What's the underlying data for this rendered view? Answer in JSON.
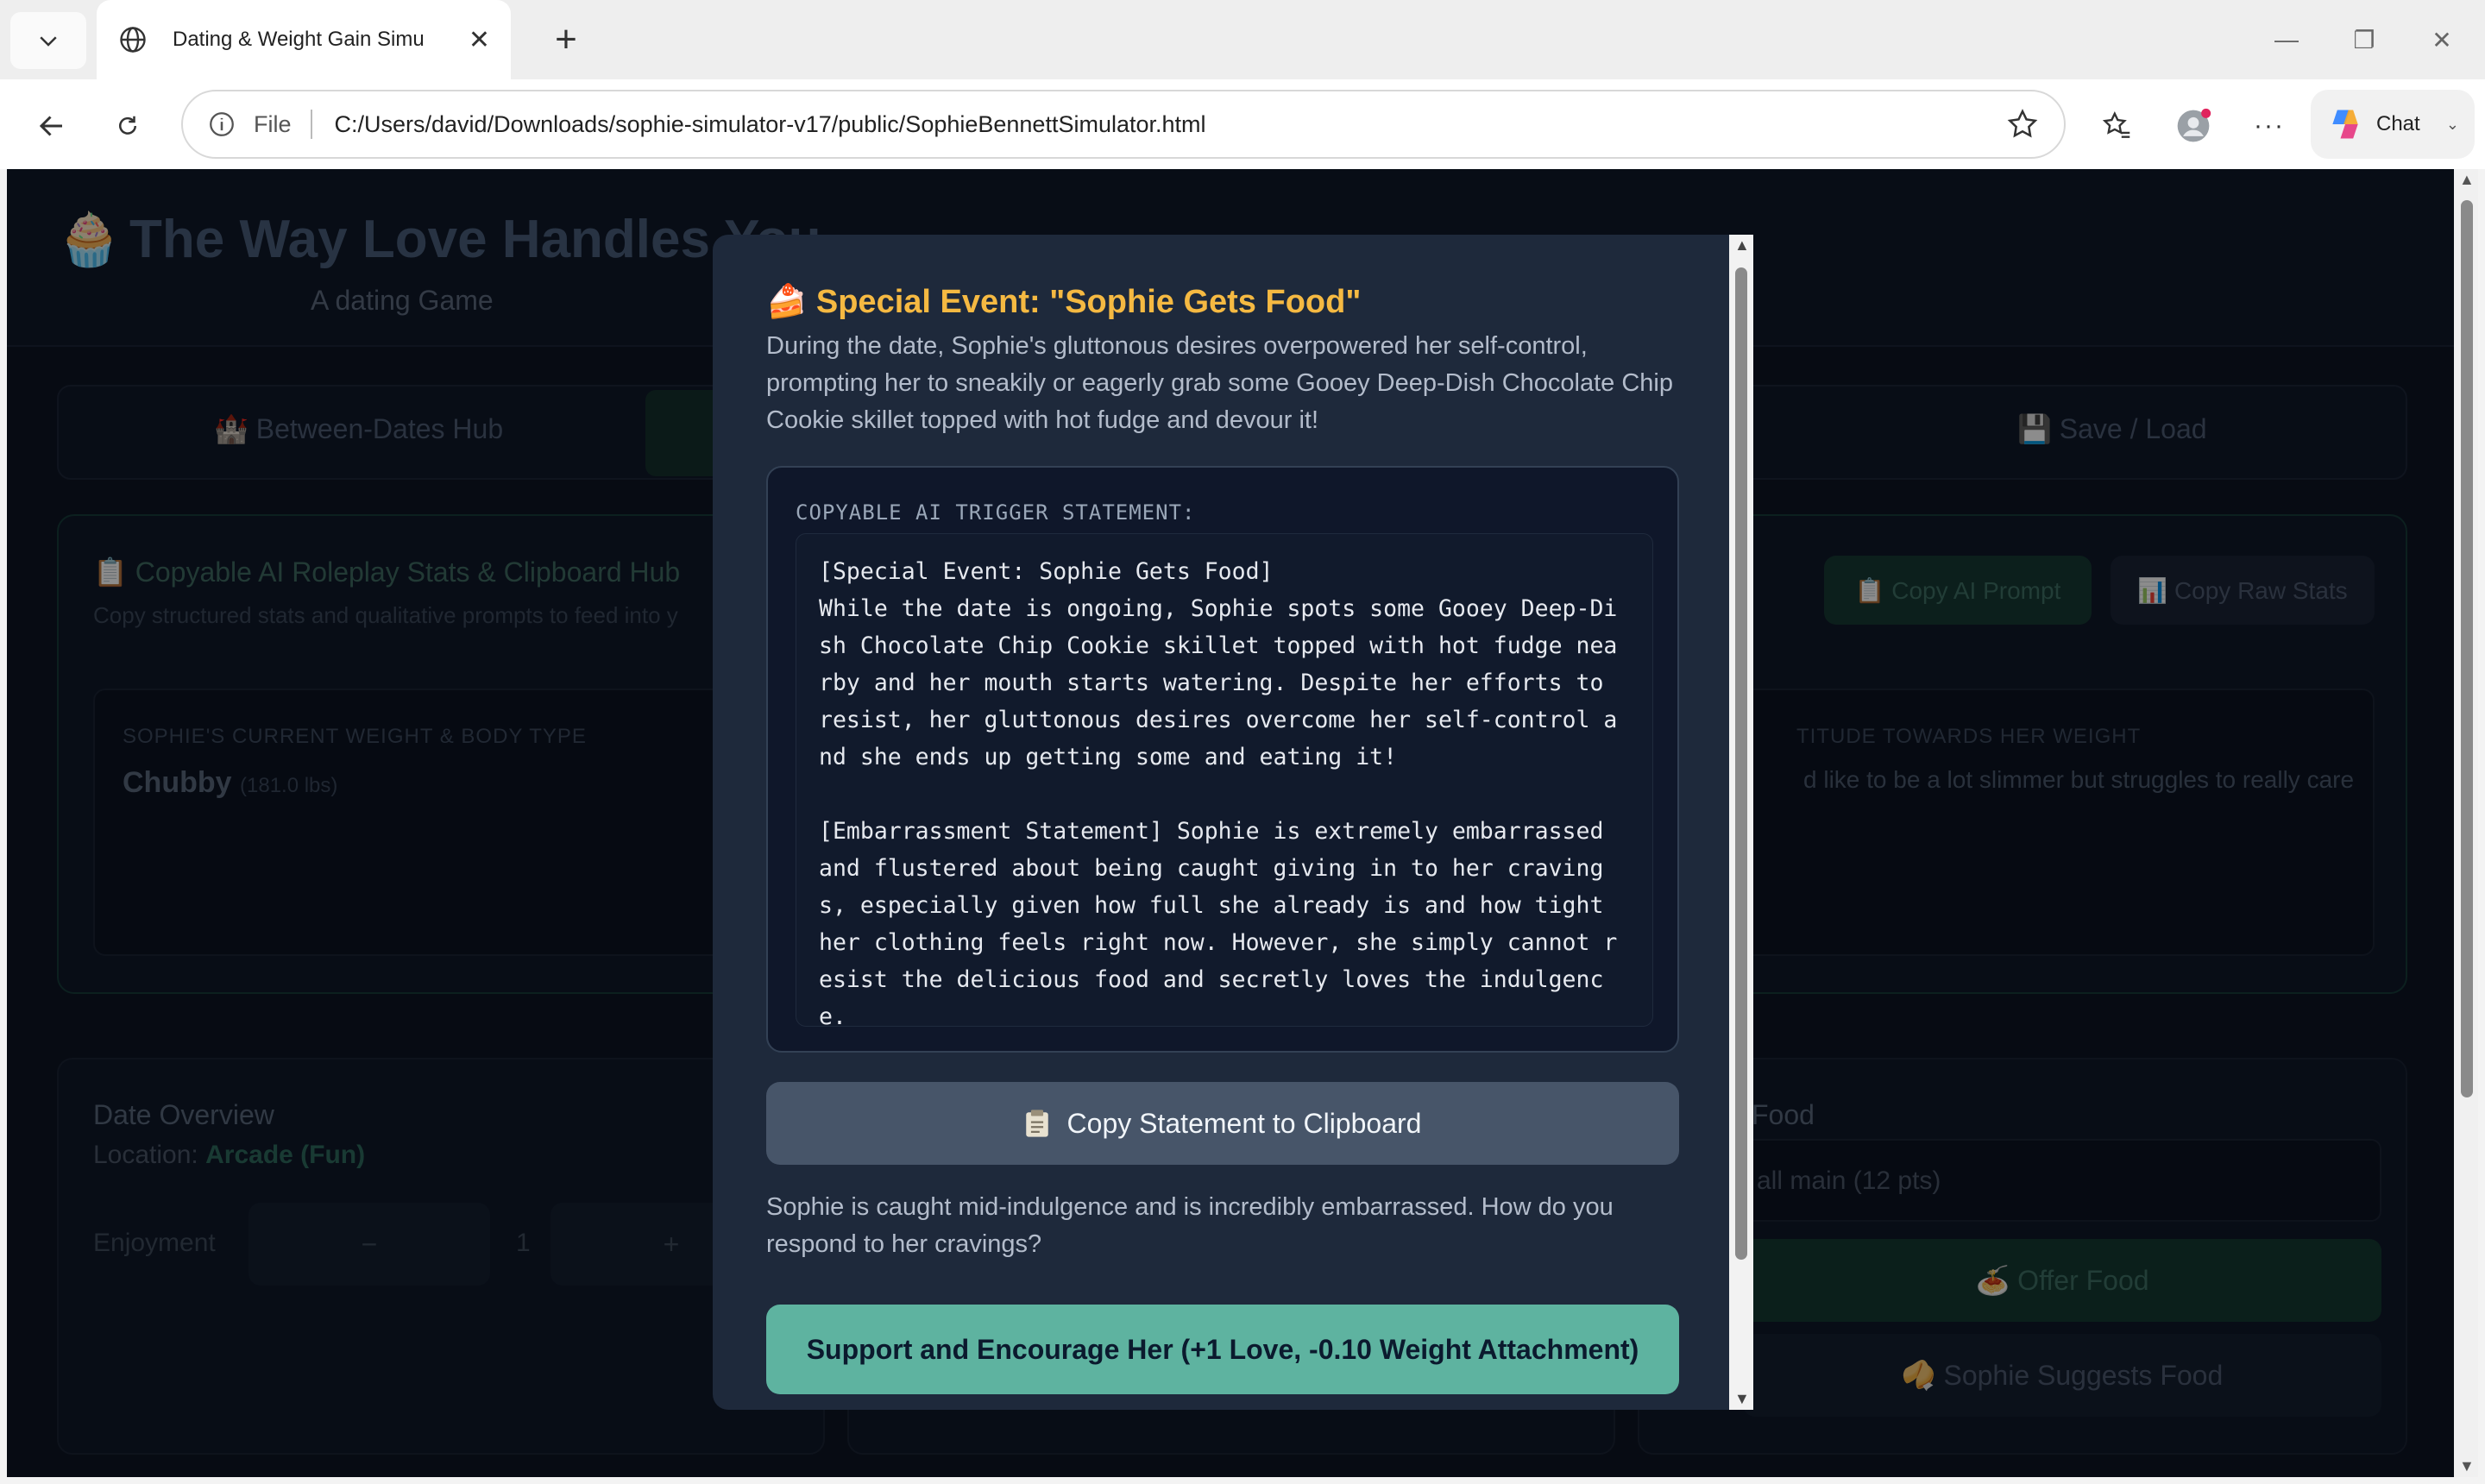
{
  "browser": {
    "tab_title": "Dating & Weight Gain Simu",
    "address_prefix": "File",
    "url": "C:/Users/david/Downloads/sophie-simulator-v17/public/SophieBennettSimulator.html",
    "chat_label": "Chat"
  },
  "background": {
    "logo": "🧁",
    "title": "The Way Love Handles You",
    "subtitle": "A dating Game",
    "nav_tabs": [
      "🏰 Between-Dates Hub",
      "💾 Save / Load"
    ],
    "hub": {
      "heading": "📋 Copyable AI Roleplay Stats & Clipboard Hub",
      "subheading": "Copy structured stats and qualitative prompts to feed into y",
      "copy_ai_prompt": "📋 Copy AI Prompt",
      "copy_raw_stats": "📊 Copy Raw Stats",
      "weight_label": "SOPHIE'S CURRENT WEIGHT & BODY TYPE",
      "weight_value": "Chubby",
      "weight_lbs": "(181.0 lbs)",
      "attitude_label": "TITUDE TOWARDS HER WEIGHT",
      "attitude_text": "d like to be a lot slimmer but struggles to really care"
    },
    "date": {
      "title": "Date Overview",
      "location_label": "Location:",
      "location_value": "Arcade (Fun)",
      "enjoyment_label": "Enjoyment",
      "minus": "−",
      "plus": "+",
      "enjoyment_value": "1"
    },
    "food": {
      "title": "Food",
      "selected": "all main (12 pts)",
      "offer": "🍝 Offer Food",
      "suggest": "🥠 Sophie Suggests Food"
    }
  },
  "modal": {
    "title": "🍰 Special Event: \"Sophie Gets Food\"",
    "description": "During the date, Sophie's gluttonous desires overpowered her self-control, prompting her to sneakily or eagerly grab some Gooey Deep-Dish Chocolate Chip Cookie skillet topped with hot fudge and devour it!",
    "trigger_label": "COPYABLE AI TRIGGER STATEMENT:",
    "statement_line1": "[Special Event: Sophie Gets Food]",
    "statement_line2": "While the date is ongoing, Sophie spots some Gooey Deep-Dish Chocolate Chip Cookie skillet topped with hot fudge nearby and her mouth starts watering. Despite her efforts to resist, her gluttonous desires overcome her self-control and she ends up getting some and eating it!",
    "statement_line3": "[Embarrassment Statement] Sophie is extremely embarrassed and flustered about being caught giving in to her cravings, especially given how full she already is and how tight her clothing feels right now. However, she simply cannot resist the delicious food and secretly loves the indulgence.",
    "copy_button": "Copy Statement to Clipboard",
    "prompt": "Sophie is caught mid-indulgence and is incredibly embarrassed. How do you respond to her cravings?",
    "support_button": "Support and Encourage Her (+1 Love, -0.10 Weight Attachment)"
  },
  "colors": {
    "modal_bg": "#1e293b",
    "title_accent": "#f5b942",
    "support_button": "#5eb3a0",
    "copy_button": "#475569"
  }
}
